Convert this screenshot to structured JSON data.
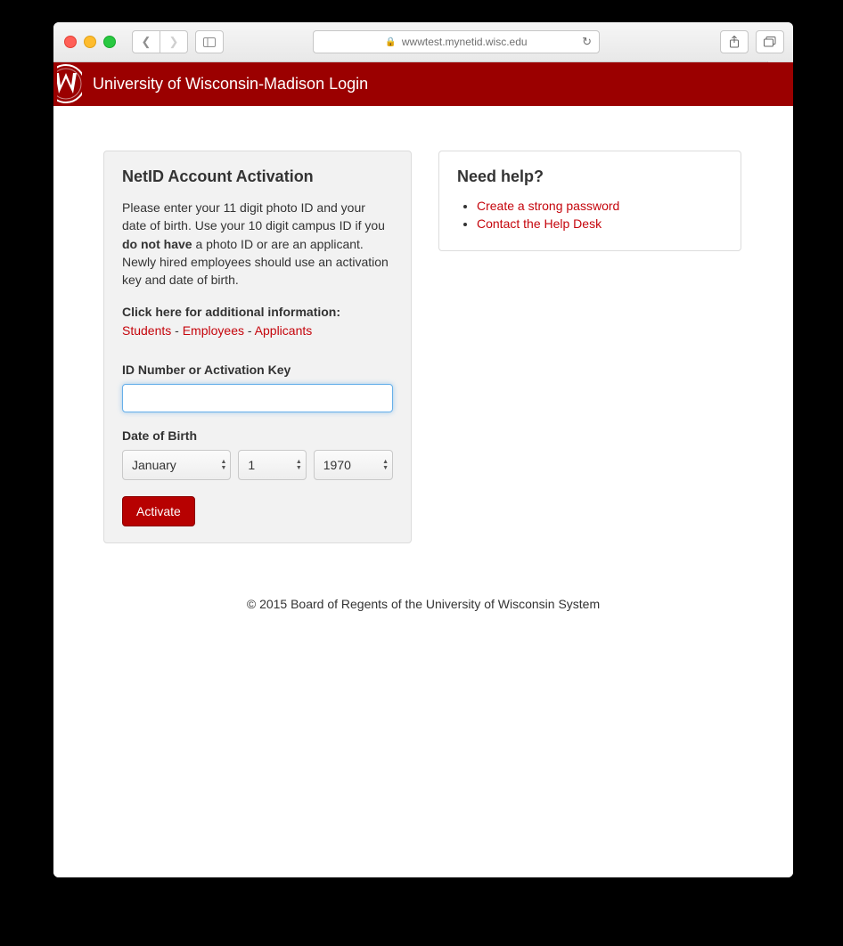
{
  "browser": {
    "url_host": "wwwtest.mynetid.wisc.edu"
  },
  "header": {
    "title": "University of Wisconsin-Madison Login"
  },
  "activation": {
    "heading": "NetID Account Activation",
    "intro_a": "Please enter your 11 digit photo ID and your date of birth. Use your 10 digit campus ID if you ",
    "intro_bold": "do not have",
    "intro_b": " a photo ID or are an applicant. Newly hired employees should use an activation key and date of birth.",
    "click_here": "Click here for additional information:",
    "link_students": "Students",
    "link_employees": "Employees",
    "link_applicants": "Applicants",
    "sep": " - ",
    "id_label": "ID Number or Activation Key",
    "id_value": "",
    "dob_label": "Date of Birth",
    "month": "January",
    "day": "1",
    "year": "1970",
    "activate_label": "Activate"
  },
  "help": {
    "heading": "Need help?",
    "links": {
      "password": "Create a strong password",
      "contact": "Contact the Help Desk"
    }
  },
  "footer": {
    "copyright": "© 2015 Board of Regents of the University of Wisconsin System"
  }
}
